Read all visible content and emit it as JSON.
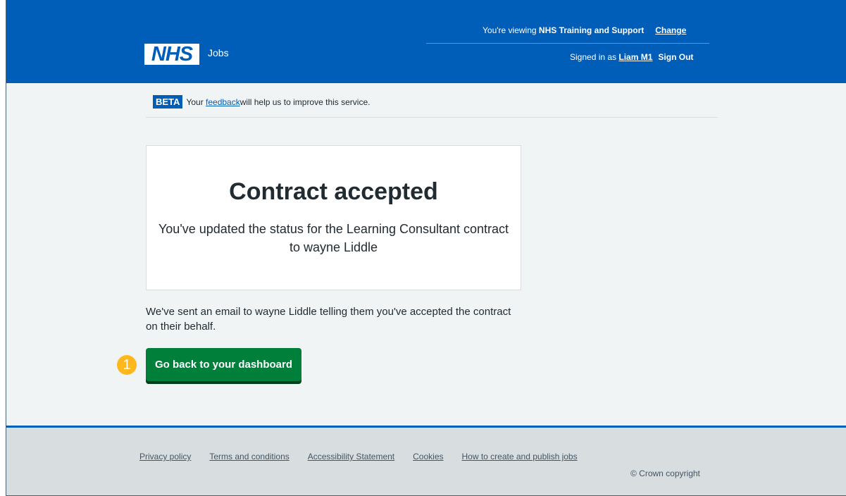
{
  "header": {
    "viewing_prefix": "You're viewing ",
    "organisation": "NHS Training and Support",
    "change_label": "Change",
    "logo_text": "NHS",
    "service_name": "Jobs",
    "signed_in_prefix": "Signed in as ",
    "user_name": "Liam M1",
    "sign_out_label": "Sign Out",
    "brand_color": "#005eb8"
  },
  "beta_banner": {
    "tag": "BETA",
    "text_before": "Your ",
    "link": "feedback",
    "text_after": " will help us to improve this service."
  },
  "confirmation_panel": {
    "title": "Contract accepted",
    "body": "You've updated the status for the Learning Consultant contract to wayne Liddle"
  },
  "info_text": "We've sent an email to wayne Liddle telling them you've accepted the contract on their behalf.",
  "primary_button": {
    "label": "Go back to your dashboard",
    "color": "#007f3b"
  },
  "step_marker": {
    "number": "1",
    "color": "#ffb81c"
  },
  "footer": {
    "links": [
      "Privacy policy",
      "Terms and conditions",
      "Accessibility Statement",
      "Cookies",
      "How to create and publish jobs"
    ],
    "copyright": "© Crown copyright"
  }
}
